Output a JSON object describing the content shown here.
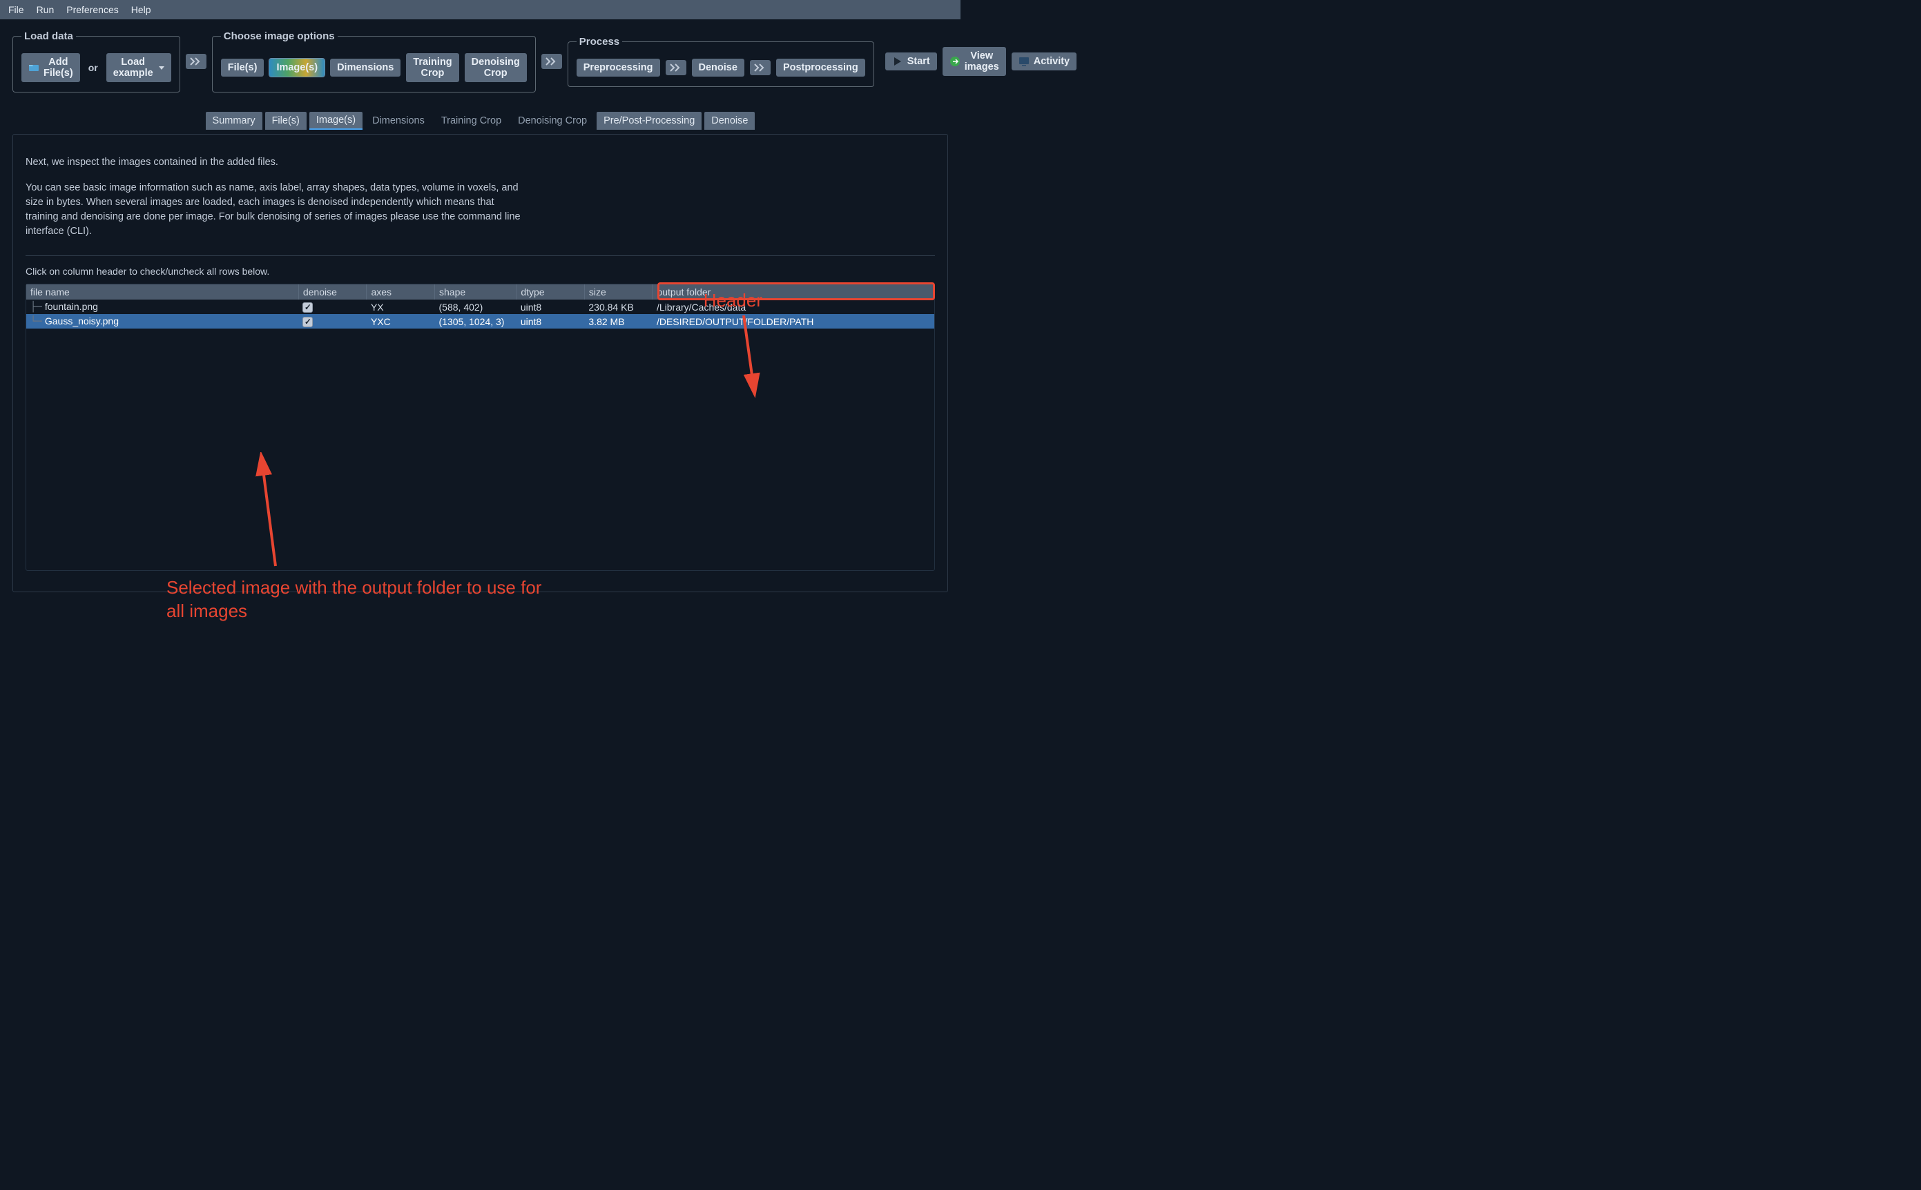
{
  "menubar": {
    "items": [
      "File",
      "Run",
      "Preferences",
      "Help"
    ]
  },
  "steps": {
    "load": {
      "legend": "Load data",
      "add_files": "Add File(s)",
      "or": "or",
      "load_example": "Load example"
    },
    "image_options": {
      "legend": "Choose image options",
      "buttons": [
        "File(s)",
        "Image(s)",
        "Dimensions",
        "Training Crop",
        "Denoising Crop"
      ],
      "active_index": 1
    },
    "process": {
      "legend": "Process",
      "buttons": [
        "Preprocessing",
        "Denoise",
        "Postprocessing"
      ]
    }
  },
  "right_actions": {
    "start": "Start",
    "view_images": "View images",
    "activity": "Activity"
  },
  "tabs": {
    "items": [
      "Summary",
      "File(s)",
      "Image(s)",
      "Dimensions",
      "Training Crop",
      "Denoising Crop",
      "Pre/Post-Processing",
      "Denoise"
    ],
    "active_index": 2,
    "pill_indices": [
      0,
      1,
      2,
      6,
      7
    ]
  },
  "panel": {
    "para1": "Next, we inspect the images contained in the added files.",
    "para2": "You can see basic image information such as name, axis label, array shapes, data types, volume in voxels, and size in bytes. When several images are loaded, each images is denoised independently which means that training and denoising are done per image. For bulk denoising of series of images please use the command line interface (CLI).",
    "hint": "Click on column header to check/uncheck all rows below."
  },
  "table": {
    "columns": [
      "file name",
      "denoise",
      "axes",
      "shape",
      "dtype",
      "size",
      "output folder"
    ],
    "widths": [
      "30%",
      "7.5%",
      "7.5%",
      "9%",
      "7.5%",
      "7.5%",
      "31%"
    ],
    "rows": [
      {
        "name": "fountain.png",
        "denoise": true,
        "axes": "YX",
        "shape": "(588, 402)",
        "dtype": "uint8",
        "size": "230.84 KB",
        "output": "/Library/Caches/data",
        "selected": false
      },
      {
        "name": "Gauss_noisy.png",
        "denoise": true,
        "axes": "YXC",
        "shape": "(1305, 1024, 3)",
        "dtype": "uint8",
        "size": "3.82 MB",
        "output": "/DESIRED/OUTPUT/FOLDER/PATH",
        "selected": true
      }
    ]
  },
  "annotations": {
    "header_label": "Header",
    "selected_label": "Selected image with the output folder to use for all images"
  }
}
